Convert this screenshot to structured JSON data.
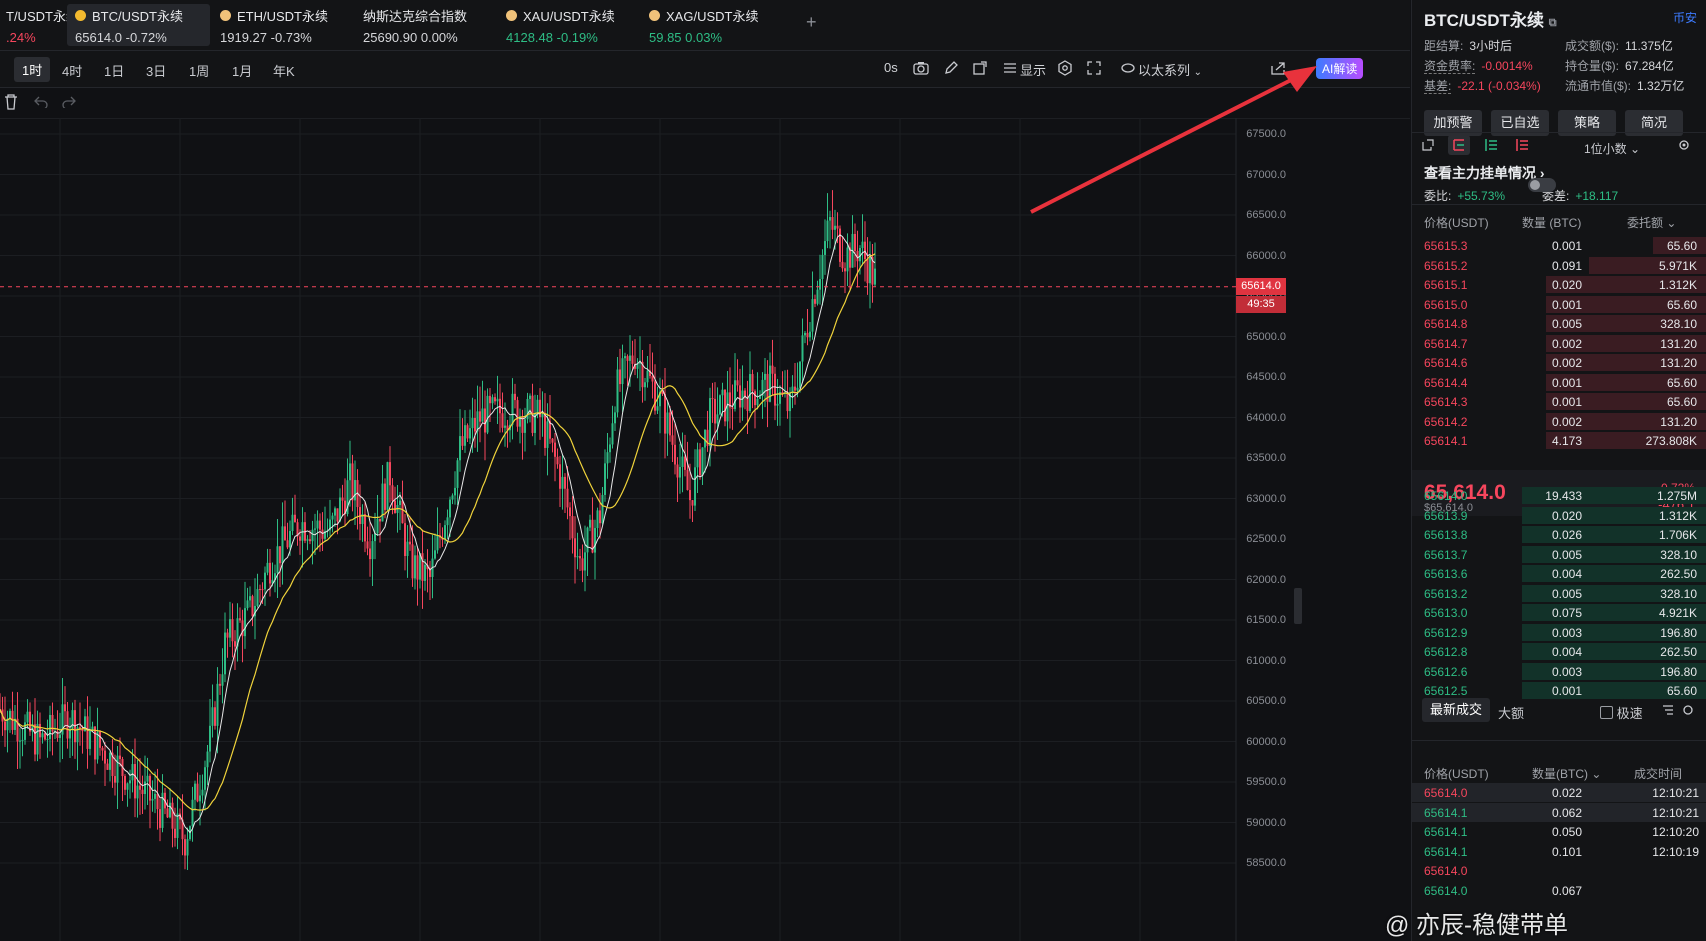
{
  "tabs": [
    {
      "name": "T/USDT永续",
      "price": "",
      "change": ".24%",
      "color": "red"
    },
    {
      "name": "BTC/USDT永续",
      "price": "65614.0",
      "change": "-0.72%",
      "color": "white",
      "active": true
    },
    {
      "name": "ETH/USDT永续",
      "price": "1919.27",
      "change": "-0.73%",
      "color": "white"
    },
    {
      "name": "纳斯达克综合指数",
      "price": "25690.90",
      "change": "0.00%",
      "color": "white"
    },
    {
      "name": "XAU/USDT永续",
      "price": "4128.48",
      "change": "-0.19%",
      "color": "green"
    },
    {
      "name": "XAG/USDT永续",
      "price": "59.85",
      "change": "0.03%",
      "color": "green"
    }
  ],
  "add_tab": "+",
  "timeframes": [
    "1时",
    "4时",
    "1日",
    "3日",
    "1周",
    "1月",
    "年K"
  ],
  "toolbar": {
    "countdown": "0s",
    "display": "显示",
    "series": "以太系列",
    "ai": "AI解读"
  },
  "chart": {
    "price_labels": [
      "67500.0",
      "67000.0",
      "66500.0",
      "66000.0",
      "65500.0",
      "65000.0",
      "64500.0",
      "64000.0",
      "63500.0",
      "63000.0",
      "62500.0",
      "62000.0",
      "61500.0",
      "61000.0",
      "60500.0",
      "60000.0",
      "59500.0",
      "59000.0",
      "58500.0"
    ],
    "current_price": "65614.0",
    "countdown": "49:35",
    "up_color": "#2ebd85",
    "down_color": "#f6465d",
    "ma_color": "#f0d33b"
  },
  "side": {
    "title": "BTC/USDT永续",
    "exchange": "币安",
    "settle_label": "距结算:",
    "settle_value": "3小时后",
    "funding_label": "资金费率:",
    "funding_value": "-0.0014%",
    "basis_label": "基差:",
    "basis_value": "-22.1 (-0.034%)",
    "turnover_label": "成交额($):",
    "turnover_value": "11.375亿",
    "oi_label": "持仓量($):",
    "oi_value": "67.284亿",
    "mcap_label": "流通市值($):",
    "mcap_value": "1.32万亿",
    "buttons": [
      "加预警",
      "已自选",
      "策略",
      "简况"
    ],
    "decimals": "1位小数",
    "main_orders": "查看主力挂单情况",
    "ratio_label": "委比:",
    "ratio_value": "+55.73%",
    "diff_label": "委差:",
    "diff_value": "+18.117",
    "ob_headers": [
      "价格(USDT)",
      "数量 (BTC)",
      "委托额"
    ],
    "asks": [
      {
        "price": "65615.3",
        "qty": "0.001",
        "amt": "65.60",
        "depth": 0.25
      },
      {
        "price": "65615.2",
        "qty": "0.091",
        "amt": "5.971K",
        "depth": 0.55
      },
      {
        "price": "65615.1",
        "qty": "0.020",
        "amt": "1.312K",
        "depth": 0.75
      },
      {
        "price": "65615.0",
        "qty": "0.001",
        "amt": "65.60",
        "depth": 0.75
      },
      {
        "price": "65614.8",
        "qty": "0.005",
        "amt": "328.10",
        "depth": 0.75
      },
      {
        "price": "65614.7",
        "qty": "0.002",
        "amt": "131.20",
        "depth": 0.75
      },
      {
        "price": "65614.6",
        "qty": "0.002",
        "amt": "131.20",
        "depth": 0.75
      },
      {
        "price": "65614.4",
        "qty": "0.001",
        "amt": "65.60",
        "depth": 0.75
      },
      {
        "price": "65614.3",
        "qty": "0.001",
        "amt": "65.60",
        "depth": 0.75
      },
      {
        "price": "65614.2",
        "qty": "0.002",
        "amt": "131.20",
        "depth": 0.75
      },
      {
        "price": "65614.1",
        "qty": "4.173",
        "amt": "273.808K",
        "depth": 0.75
      }
    ],
    "mid_price": "65,614.0",
    "mid_usd": "$65,614.0",
    "mid_change_pct": "-0.72%",
    "mid_change": "-476.1",
    "bids": [
      {
        "price": "65614.0",
        "qty": "19.433",
        "amt": "1.275M",
        "depth": 0.86
      },
      {
        "price": "65613.9",
        "qty": "0.020",
        "amt": "1.312K",
        "depth": 0.86
      },
      {
        "price": "65613.8",
        "qty": "0.026",
        "amt": "1.706K",
        "depth": 0.86
      },
      {
        "price": "65613.7",
        "qty": "0.005",
        "amt": "328.10",
        "depth": 0.86
      },
      {
        "price": "65613.6",
        "qty": "0.004",
        "amt": "262.50",
        "depth": 0.86
      },
      {
        "price": "65613.2",
        "qty": "0.005",
        "amt": "328.10",
        "depth": 0.86
      },
      {
        "price": "65613.0",
        "qty": "0.075",
        "amt": "4.921K",
        "depth": 0.86
      },
      {
        "price": "65612.9",
        "qty": "0.003",
        "amt": "196.80",
        "depth": 0.86
      },
      {
        "price": "65612.8",
        "qty": "0.004",
        "amt": "262.50",
        "depth": 0.86
      },
      {
        "price": "65612.6",
        "qty": "0.003",
        "amt": "196.80",
        "depth": 0.86
      },
      {
        "price": "65612.5",
        "qty": "0.001",
        "amt": "65.60",
        "depth": 0.86
      }
    ],
    "trade_tabs": [
      "最新成交",
      "大额"
    ],
    "speed": "极速",
    "trade_headers": [
      "价格(USDT)",
      "数量(BTC)",
      "成交时间"
    ],
    "trades": [
      {
        "price": "65614.0",
        "qty": "0.022",
        "time": "12:10:21",
        "side": "sell"
      },
      {
        "price": "65614.1",
        "qty": "0.062",
        "time": "12:10:21",
        "side": "buy"
      },
      {
        "price": "65614.1",
        "qty": "0.050",
        "time": "12:10:20",
        "side": "buy"
      },
      {
        "price": "65614.1",
        "qty": "0.101",
        "time": "12:10:19",
        "side": "buy"
      },
      {
        "price": "65614.0",
        "qty": "",
        "time": "",
        "side": "sell"
      },
      {
        "price": "65614.0",
        "qty": "0.067",
        "time": "",
        "side": "buy"
      }
    ]
  },
  "watermark": "@ 亦辰-稳健带单"
}
